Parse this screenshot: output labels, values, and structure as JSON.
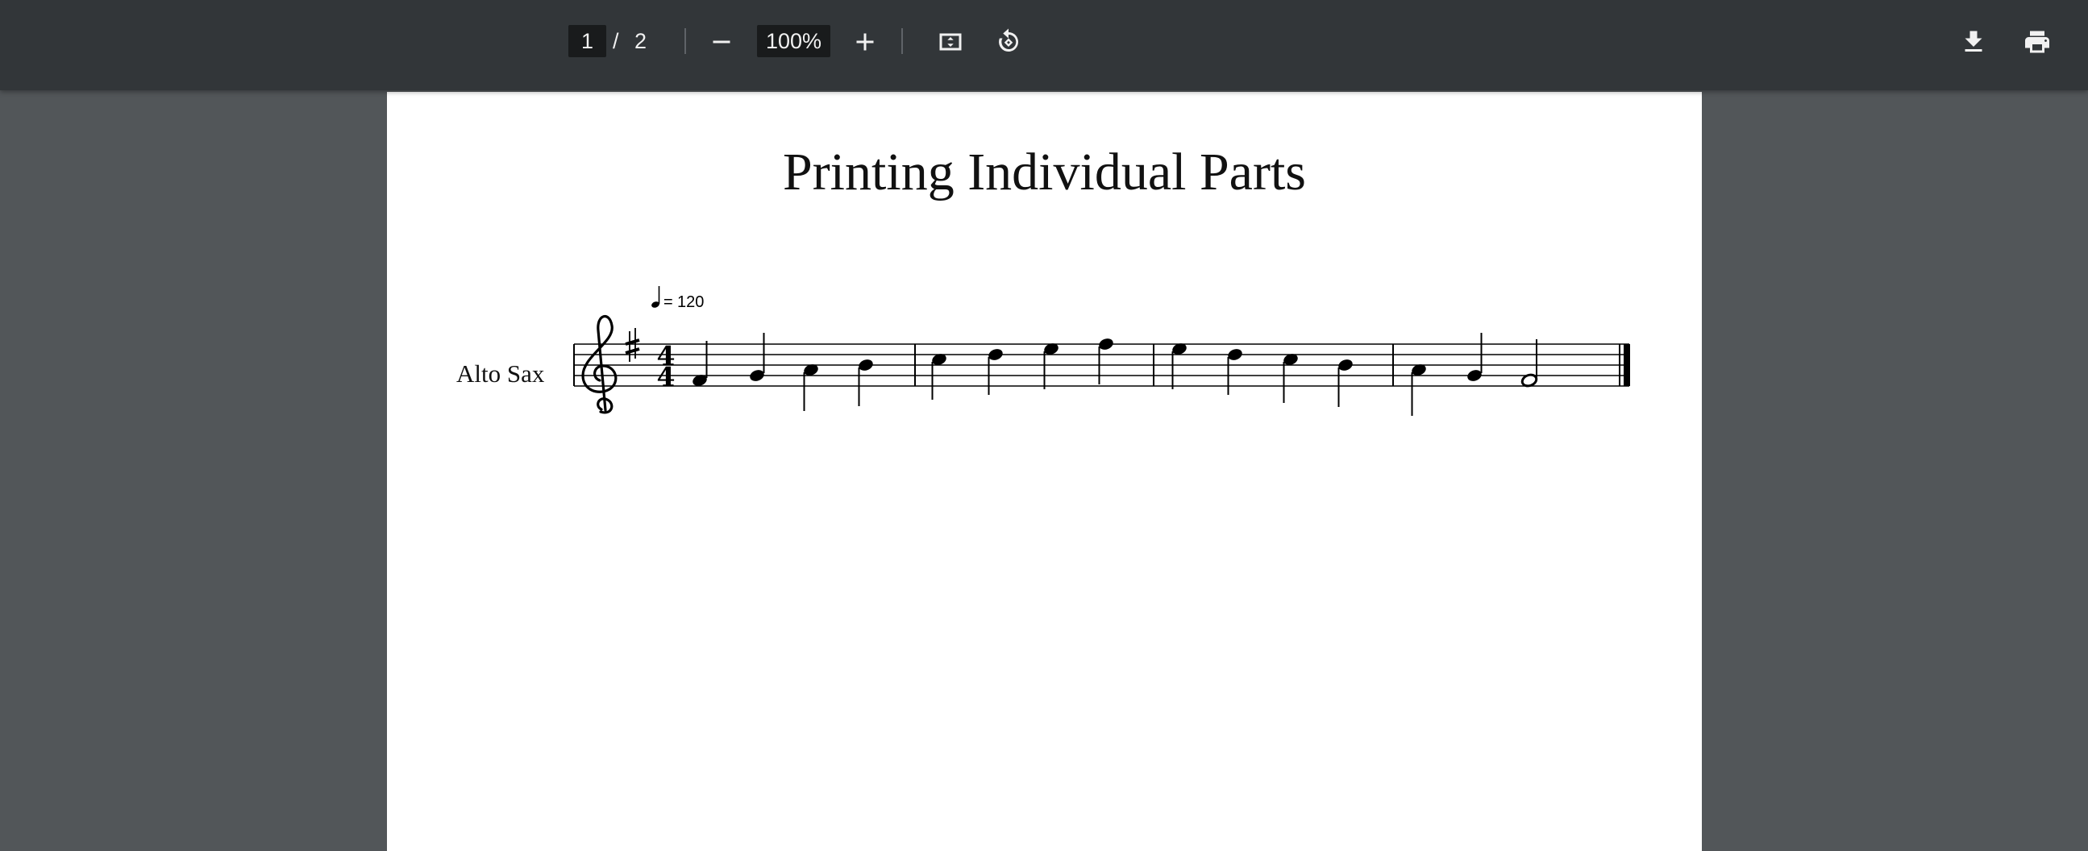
{
  "toolbar": {
    "current_page": "1",
    "page_separator": "/",
    "total_pages": "2",
    "zoom": "100%",
    "icons": [
      "zoom-out-icon",
      "zoom-in-icon",
      "fit-page-icon",
      "rotate-icon",
      "download-icon",
      "print-icon"
    ]
  },
  "document": {
    "title": "Printing Individual Parts",
    "instrument": "Alto Sax",
    "tempo_value": "120",
    "time_signature_top": "4",
    "time_signature_bottom": "4",
    "key_signature": "G major (1 sharp)",
    "clef": "treble"
  },
  "colors": {
    "toolbar_bg": "#323639",
    "viewer_bg": "#525659",
    "input_bg": "#191b1c",
    "page_bg": "#ffffff"
  }
}
